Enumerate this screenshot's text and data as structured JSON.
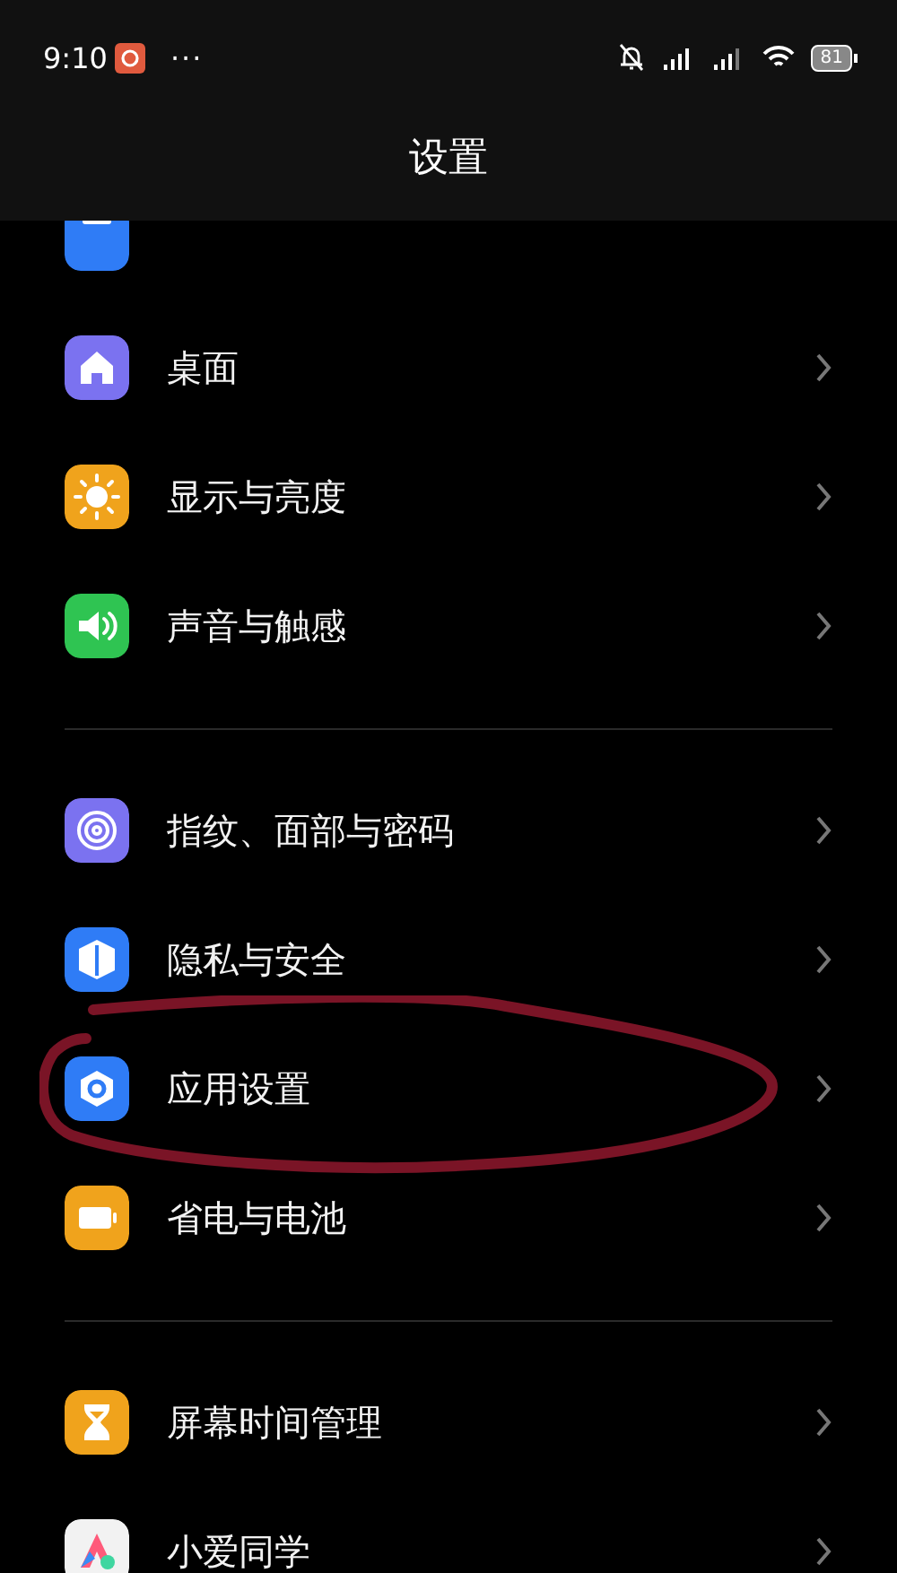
{
  "status_bar": {
    "time": "9:10",
    "more": "···",
    "battery": "81"
  },
  "header": {
    "title": "设置"
  },
  "groups": [
    {
      "items": [
        {
          "kind": "apps",
          "circled": false
        },
        {
          "kind": "home",
          "label": "桌面",
          "circled": false
        },
        {
          "kind": "sun",
          "label": "显示与亮度",
          "circled": false
        },
        {
          "kind": "sound",
          "label": "声音与触感",
          "circled": false
        }
      ]
    },
    {
      "items": [
        {
          "kind": "fingerprint",
          "label": "指纹、面部与密码",
          "circled": false
        },
        {
          "kind": "shield",
          "label": "隐私与安全",
          "circled": false
        },
        {
          "kind": "gear",
          "label": "应用设置",
          "circled": true
        },
        {
          "kind": "battery",
          "label": "省电与电池",
          "circled": false
        }
      ]
    },
    {
      "items": [
        {
          "kind": "hourglass",
          "label": "屏幕时间管理",
          "circled": false
        },
        {
          "kind": "assistant",
          "label": "小爱同学",
          "circled": false
        }
      ]
    }
  ]
}
